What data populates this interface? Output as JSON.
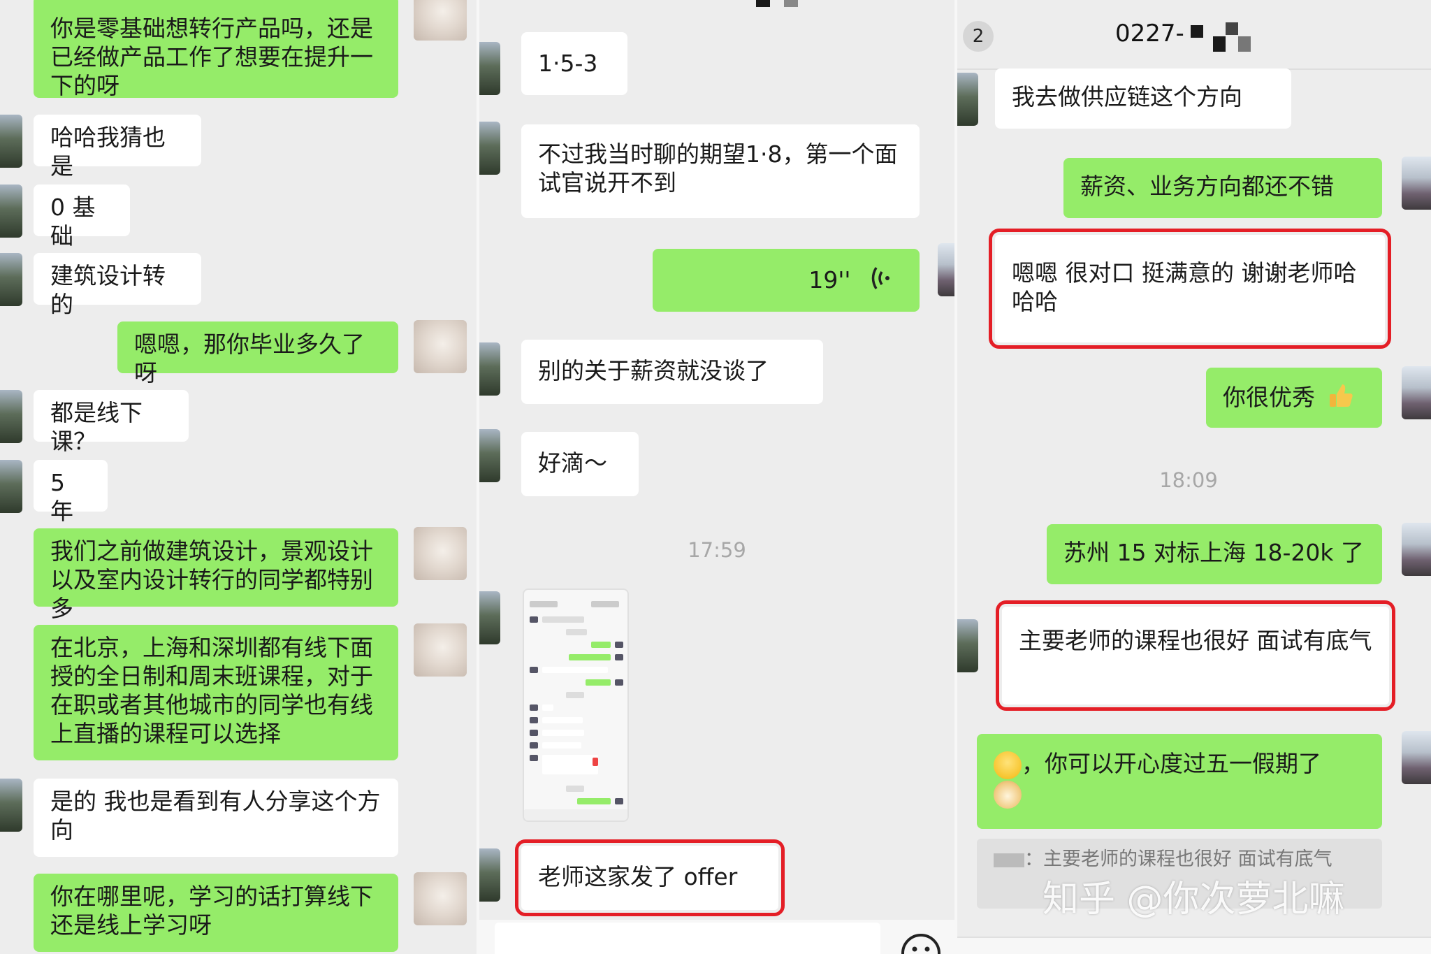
{
  "panel1": {
    "messages": [
      {
        "text": "你是零基础想转行产品吗，还是已经做产品工作了想要在提升一下的呀"
      },
      {
        "text": "哈哈我猜也是"
      },
      {
        "text": "0 基础"
      },
      {
        "text": "建筑设计转的"
      },
      {
        "text": "嗯嗯，那你毕业多久了呀"
      },
      {
        "text": "都是线下课？"
      },
      {
        "text": "5 年"
      },
      {
        "text": "我们之前做建筑设计，景观设计以及室内设计转行的同学都特别多"
      },
      {
        "text": "在北京，上海和深圳都有线下面授的全日制和周末班课程，对于在职或者其他城市的同学也有线上直播的课程可以选择"
      },
      {
        "text": "是的 我也是看到有人分享这个方向"
      },
      {
        "text": "你在哪里呢，学习的话打算线下还是线上学习呀"
      }
    ]
  },
  "panel2": {
    "messages": [
      {
        "text": "1·5-3"
      },
      {
        "text": "不过我当时聊的期望1·8，第一个面试官说开不到"
      },
      {
        "text": "19''"
      },
      {
        "text": "别的关于薪资就没谈了"
      },
      {
        "text": "好滴～"
      },
      {
        "text": "老师这家发了 offer"
      }
    ],
    "timestamp": "17:59",
    "voice_icon": "voice-wave-icon",
    "emoji_button_icon": "smiley-icon"
  },
  "panel3": {
    "header": {
      "badge": "2",
      "title": "0227-"
    },
    "messages": [
      {
        "text": "我去做供应链这个方向"
      },
      {
        "text": "薪资、业务方向都还不错"
      },
      {
        "text": "嗯嗯 很对口 挺满意的 谢谢老师哈哈哈"
      },
      {
        "text": "你很优秀"
      },
      {
        "text": "苏州 15 对标上海 18-20k 了"
      },
      {
        "text": "主要老师的课程也很好 面试有底气"
      },
      {
        "text": "，你可以开心度过五一假期了"
      }
    ],
    "timestamp": "18:09",
    "quote": {
      "prefix": "：",
      "text": "主要老师的课程也很好 面试有底气"
    },
    "thumbs_icon": "thumbs-up-icon",
    "grin_icon": "grinning-face-icon",
    "doge_icon": "doge-icon"
  },
  "watermark": "知乎 @你次萝北嘛",
  "colors": {
    "outgoing": "#95ec69",
    "incoming": "#ffffff",
    "highlight": "#e41e26",
    "background": "#ededed"
  }
}
